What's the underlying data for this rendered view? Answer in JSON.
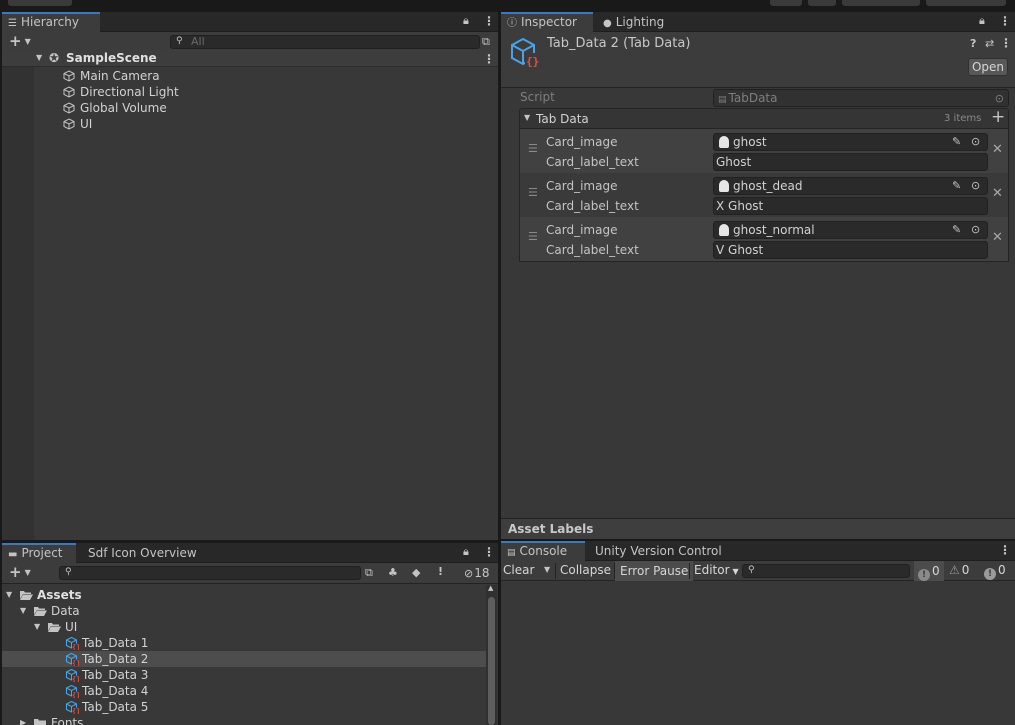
{
  "hierarchy": {
    "tab_label": "Hierarchy",
    "search_placeholder": "All",
    "scene_name": "SampleScene",
    "items": [
      "Main Camera",
      "Directional Light",
      "Global Volume",
      "UI"
    ]
  },
  "inspector": {
    "tabs": [
      "Inspector",
      "Lighting"
    ],
    "object_title": "Tab_Data 2 (Tab Data)",
    "open_button": "Open",
    "script_label": "Script",
    "script_value": "TabData",
    "list_title": "Tab Data",
    "list_count": "3 items",
    "image_label": "Card_image",
    "text_label": "Card_label_text",
    "entries": [
      {
        "image": "ghost",
        "text": "Ghost"
      },
      {
        "image": "ghost_dead",
        "text": "X Ghost"
      },
      {
        "image": "ghost_normal",
        "text": "V Ghost"
      }
    ],
    "asset_labels": "Asset Labels"
  },
  "project": {
    "tabs": [
      "Project",
      "Sdf Icon Overview"
    ],
    "hidden_count": "18",
    "tree": [
      {
        "label": "Assets",
        "level": 0,
        "kind": "folder-open",
        "bold": true
      },
      {
        "label": "Data",
        "level": 1,
        "kind": "folder-open"
      },
      {
        "label": "UI",
        "level": 2,
        "kind": "folder-open"
      },
      {
        "label": "Tab_Data 1",
        "level": 3,
        "kind": "asset"
      },
      {
        "label": "Tab_Data 2",
        "level": 3,
        "kind": "asset",
        "selected": true
      },
      {
        "label": "Tab_Data 3",
        "level": 3,
        "kind": "asset"
      },
      {
        "label": "Tab_Data 4",
        "level": 3,
        "kind": "asset"
      },
      {
        "label": "Tab_Data 5",
        "level": 3,
        "kind": "asset"
      },
      {
        "label": "Fonts",
        "level": 1,
        "kind": "folder"
      }
    ]
  },
  "console": {
    "tabs": [
      "Console",
      "Unity Version Control"
    ],
    "buttons": [
      "Clear",
      "Collapse",
      "Error Pause",
      "Editor"
    ],
    "counts": {
      "errors": "0",
      "warnings": "0",
      "info": "0"
    }
  },
  "colors": {
    "accent": "#3a79bb",
    "asset_icon_blue": "#4aa3e6",
    "asset_icon_red": "#e8503a"
  }
}
